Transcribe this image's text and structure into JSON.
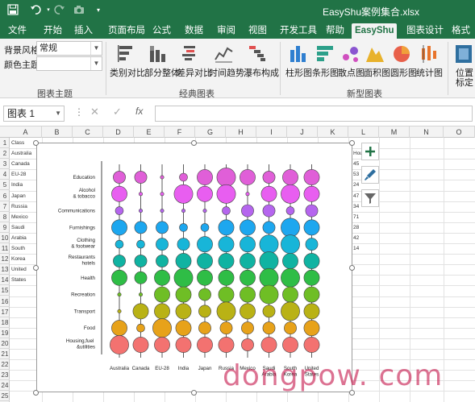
{
  "titlebar": {
    "title": "EasyShu案例集合.xlsx"
  },
  "ribbon_tabs": [
    "文件",
    "开始",
    "插入",
    "页面布局",
    "公式",
    "数据",
    "审阅",
    "视图",
    "开发工具",
    "帮助",
    "EasyShu",
    "图表设计",
    "格式"
  ],
  "active_tab": "EasyShu",
  "ribbon": {
    "theme_group": {
      "bg_style_label": "背景风格",
      "bg_style_value": "常规",
      "color_theme_label": "颜色主题",
      "color_theme_value": "",
      "group_label": "图表主题"
    },
    "classic_group": {
      "buttons": [
        "类别对比",
        "部分整体",
        "差异对比",
        "时间趋势",
        "瀑布构成"
      ],
      "group_label": "经典图表"
    },
    "new_group": {
      "buttons": [
        "柱形图",
        "条形图",
        "散点图",
        "面积图",
        "圆形图",
        "统计图"
      ],
      "group_label": "新型图表"
    },
    "position": {
      "line1": "位置",
      "line2": "标定"
    }
  },
  "formula_bar": {
    "name_box": "图表 1",
    "fx_label": "fx"
  },
  "sheet": {
    "columns": [
      "A",
      "B",
      "C",
      "D",
      "E",
      "F",
      "G",
      "H",
      "I",
      "J",
      "K",
      "L",
      "M",
      "N",
      "O"
    ],
    "rows": [
      "1",
      "2",
      "3",
      "4",
      "5",
      "6",
      "7",
      "8",
      "9",
      "10",
      "11",
      "12",
      "13",
      "14",
      "15",
      "16",
      "17",
      "18",
      "19",
      "20",
      "21",
      "22",
      "23",
      "24",
      "25"
    ],
    "col_a": [
      "Class",
      "Australia",
      "Canada",
      "EU-28",
      "India",
      "Japan",
      "Russia",
      "Mexico",
      "Saudi",
      "Arabia",
      "South",
      "Korea",
      "United",
      "States"
    ],
    "col_l": [
      "Hou",
      "45",
      "53",
      "24",
      "47",
      "34",
      "71",
      "28",
      "42",
      "14"
    ]
  },
  "chart_data": {
    "type": "bubble-matrix",
    "categories": [
      "Australia",
      "Canada",
      "EU-28",
      "India",
      "Japan",
      "Russia",
      "Mexico",
      "Saudi Arabia",
      "South Korea",
      "United States"
    ],
    "rows": [
      "Education",
      "Alcohol & tobacco",
      "Communications",
      "Furnishings",
      "Clothing & footwear",
      "Restaurants hotels",
      "Health",
      "Recreation",
      "Transport",
      "Food",
      "Housing,fuel &utilities"
    ],
    "row_colors": [
      "#e05fd8",
      "#e85ef0",
      "#b565ee",
      "#1da7ef",
      "#18b5d8",
      "#10b3a2",
      "#2fbd46",
      "#6fbe25",
      "#b9b215",
      "#e7a21a",
      "#f37270"
    ],
    "sizes": [
      [
        3,
        3,
        1,
        2,
        4,
        5,
        4,
        3,
        4,
        4
      ],
      [
        4,
        1,
        1,
        5,
        4,
        5,
        1,
        4,
        5,
        4
      ],
      [
        2,
        1,
        1,
        1,
        1,
        2,
        3,
        3,
        2,
        3
      ],
      [
        4,
        3,
        3,
        2,
        2,
        4,
        4,
        3,
        5,
        4
      ],
      [
        2,
        2,
        3,
        3,
        4,
        4,
        4,
        5,
        5,
        3
      ],
      [
        3,
        3,
        3,
        4,
        4,
        4,
        4,
        5,
        4,
        4
      ],
      [
        4,
        3,
        4,
        5,
        4,
        4,
        4,
        5,
        5,
        4
      ],
      [
        1,
        1,
        4,
        4,
        3,
        4,
        4,
        5,
        4,
        4
      ],
      [
        1,
        4,
        4,
        4,
        3,
        5,
        4,
        3,
        5,
        4
      ],
      [
        4,
        2,
        5,
        4,
        3,
        3,
        3,
        3,
        3,
        4
      ],
      [
        5,
        4,
        4,
        4,
        4,
        4,
        3,
        4,
        4,
        4
      ]
    ]
  },
  "watermark": "dongpow. com"
}
